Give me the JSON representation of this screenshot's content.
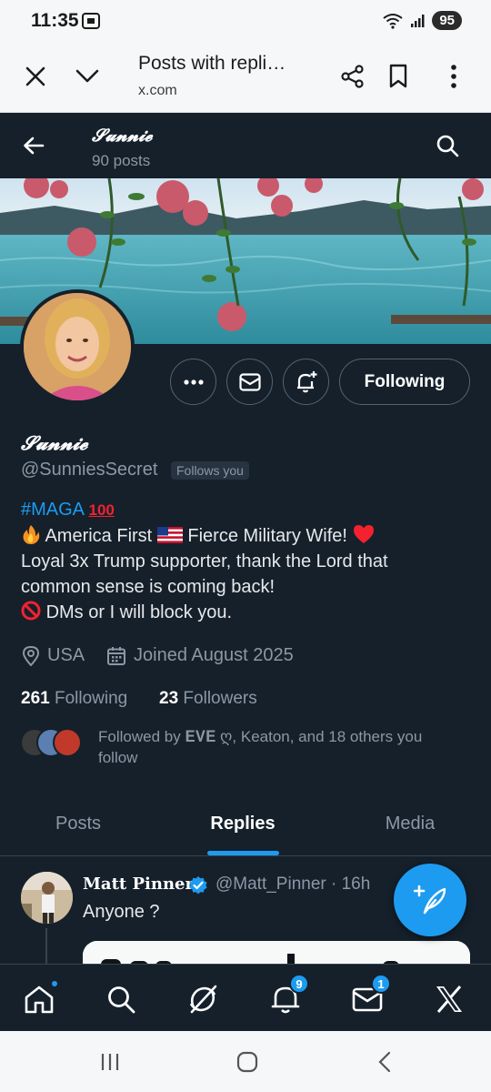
{
  "status_bar": {
    "time": "11:35",
    "battery": "95",
    "icons": [
      "sim-icon",
      "wifi-icon",
      "signal-icon",
      "battery-icon"
    ]
  },
  "browser": {
    "title": "Posts with repli…",
    "url": "x.com"
  },
  "header": {
    "name": "𝓢𝓾𝓷𝓷𝓲𝓮",
    "posts_count": "90 posts"
  },
  "profile": {
    "display_name": "𝓢𝓾𝓷𝓷𝓲𝓮",
    "handle": "@SunniesSecret",
    "follows_you": "Follows you",
    "follow_button": "Following",
    "bio_hashtag": "#MAGA",
    "bio_hundred": "100",
    "bio_line2": "America First",
    "bio_line2b": "Fierce Military Wife!",
    "bio_line3": "Loyal 3x Trump supporter, thank the Lord that",
    "bio_line4": "common sense is coming back!",
    "bio_line5": "DMs or I will block you.",
    "location": "USA",
    "joined": "Joined August 2025",
    "following_count": "261",
    "following_label": "Following",
    "followers_count": "23",
    "followers_label": "Followers",
    "followed_by_line1": "Followed by 𝐄𝐕𝐄 ღ, Keaton, and 18 others you",
    "followed_by_line2": "follow"
  },
  "tabs": [
    {
      "label": "Posts",
      "active": false
    },
    {
      "label": "Replies",
      "active": true
    },
    {
      "label": "Media",
      "active": false
    }
  ],
  "post": {
    "author": "Matt Pinner",
    "handle_time": "@Matt_Pinner · 16h",
    "text": "Anyone ?"
  },
  "bottom_nav": {
    "notifications_badge": "9",
    "messages_badge": "1"
  },
  "colors": {
    "accent": "#1d9bf0",
    "background": "#15202b",
    "muted": "#8b98a5",
    "heart": "#f4212e"
  }
}
